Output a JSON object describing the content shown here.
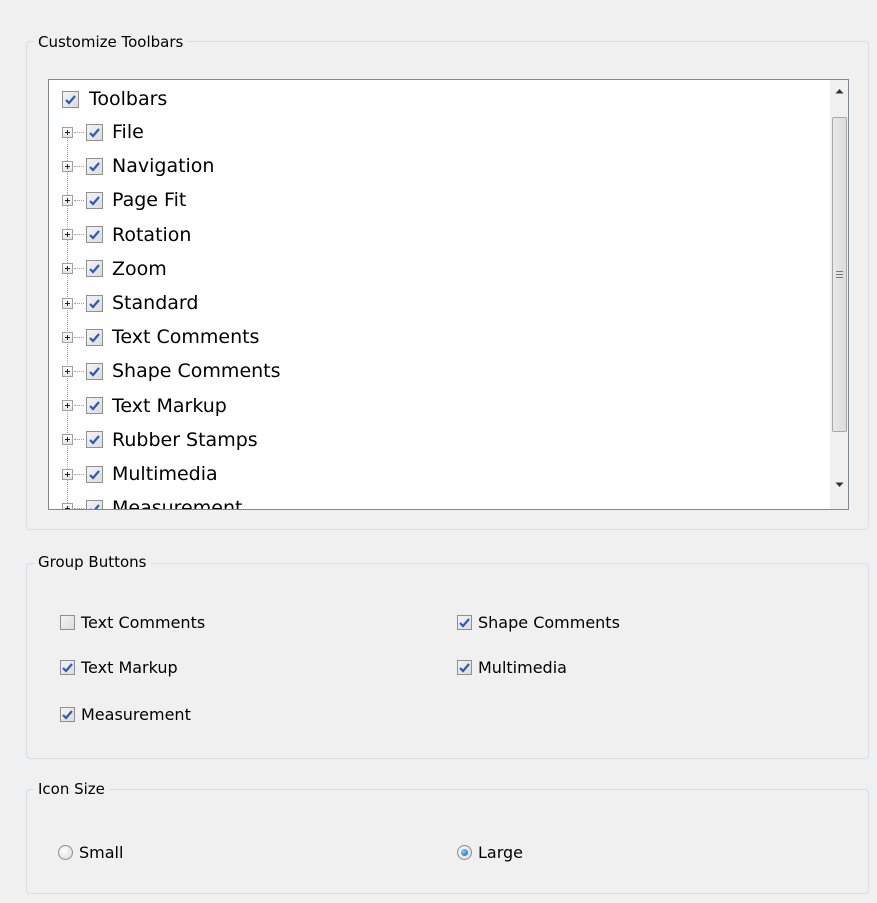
{
  "customize": {
    "legend": "Customize Toolbars",
    "root": {
      "label": "Toolbars",
      "checked": true
    },
    "items": [
      {
        "label": "File",
        "checked": true
      },
      {
        "label": "Navigation",
        "checked": true
      },
      {
        "label": "Page Fit",
        "checked": true
      },
      {
        "label": "Rotation",
        "checked": true
      },
      {
        "label": "Zoom",
        "checked": true
      },
      {
        "label": "Standard",
        "checked": true
      },
      {
        "label": "Text Comments",
        "checked": true
      },
      {
        "label": "Shape Comments",
        "checked": true
      },
      {
        "label": "Text Markup",
        "checked": true
      },
      {
        "label": "Rubber Stamps",
        "checked": true
      },
      {
        "label": "Multimedia",
        "checked": true
      },
      {
        "label": "Measurement",
        "checked": true
      }
    ]
  },
  "group_buttons": {
    "legend": "Group Buttons",
    "options": [
      {
        "label": "Text Comments",
        "checked": false
      },
      {
        "label": "Shape Comments",
        "checked": true
      },
      {
        "label": "Text Markup",
        "checked": true
      },
      {
        "label": "Multimedia",
        "checked": true
      },
      {
        "label": "Measurement",
        "checked": true
      }
    ]
  },
  "icon_size": {
    "legend": "Icon Size",
    "options": [
      {
        "label": "Small",
        "selected": false
      },
      {
        "label": "Large",
        "selected": true
      }
    ]
  },
  "colors": {
    "check": "#2b59c3",
    "radio_selected": "#0a5ea8",
    "group_border": "#d5dfe5"
  }
}
